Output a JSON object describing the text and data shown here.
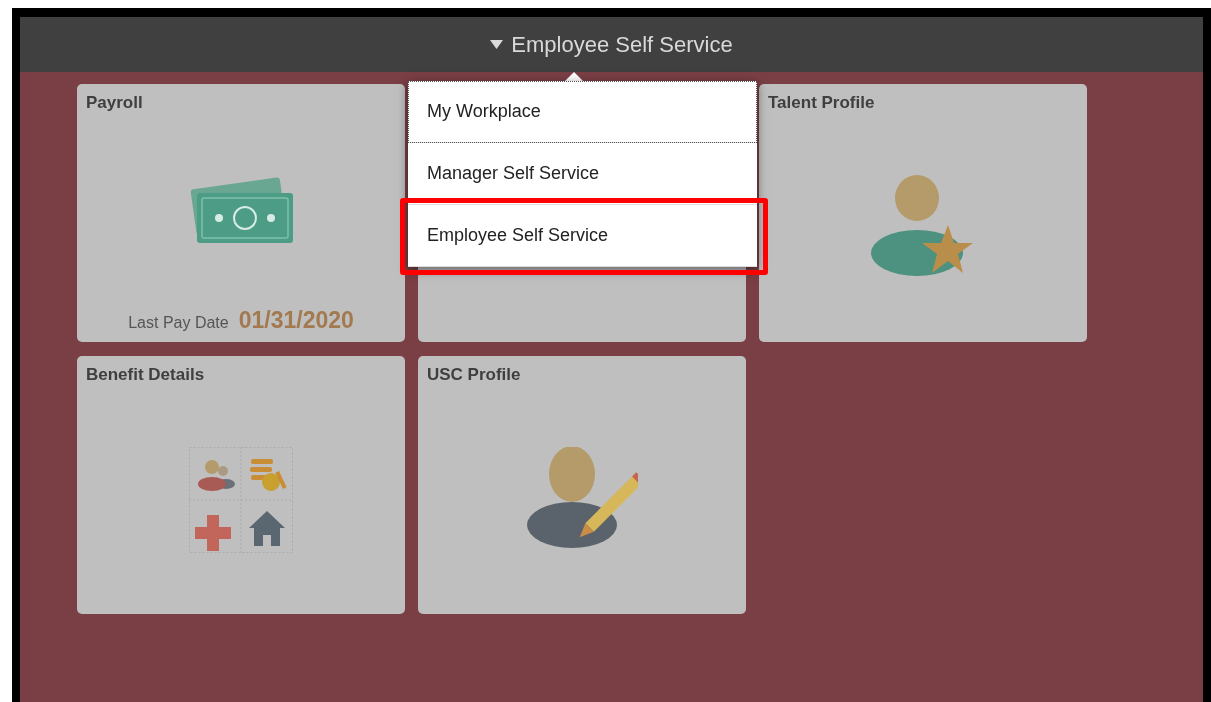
{
  "header": {
    "title": "Employee Self Service"
  },
  "menu": [
    {
      "label": "My Workplace",
      "focused": true,
      "highlighted": false
    },
    {
      "label": "Manager Self Service",
      "focused": false,
      "highlighted": false
    },
    {
      "label": "Employee Self Service",
      "focused": false,
      "highlighted": true
    }
  ],
  "tiles": [
    {
      "kind": "payroll",
      "title": "Payroll",
      "footer_label": "Last Pay Date",
      "footer_value": "01/31/2020"
    },
    {
      "kind": "blank"
    },
    {
      "kind": "talent",
      "title": "Talent Profile"
    },
    {
      "kind": "benefits",
      "title": "Benefit Details"
    },
    {
      "kind": "profile",
      "title": "USC Profile"
    }
  ]
}
